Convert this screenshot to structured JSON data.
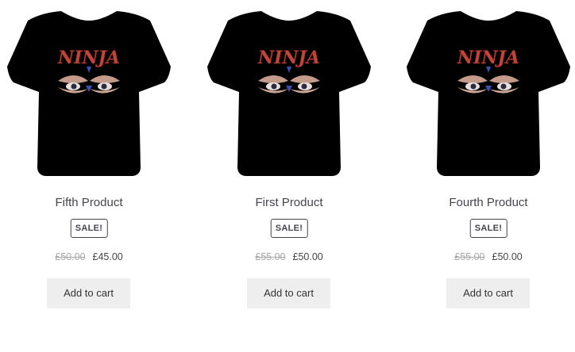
{
  "products": [
    {
      "title": "Fifth Product",
      "sale_badge": "SALE!",
      "old_price": "£50.00",
      "new_price": "£45.00",
      "add_to_cart_label": "Add to cart",
      "image_text": "NINJA",
      "image": "ninja-tshirt-icon"
    },
    {
      "title": "First Product",
      "sale_badge": "SALE!",
      "old_price": "£55.00",
      "new_price": "£50.00",
      "add_to_cart_label": "Add to cart",
      "image_text": "NINJA",
      "image": "ninja-tshirt-icon"
    },
    {
      "title": "Fourth Product",
      "sale_badge": "SALE!",
      "old_price": "£55.00",
      "new_price": "£50.00",
      "add_to_cart_label": "Add to cart",
      "image_text": "NINJA",
      "image": "ninja-tshirt-icon"
    }
  ],
  "colors": {
    "shirt": "#000000",
    "logo": "#c0473a",
    "button_bg": "#eeeeee",
    "text": "#43454b",
    "strike_price": "#a7a7a7"
  }
}
